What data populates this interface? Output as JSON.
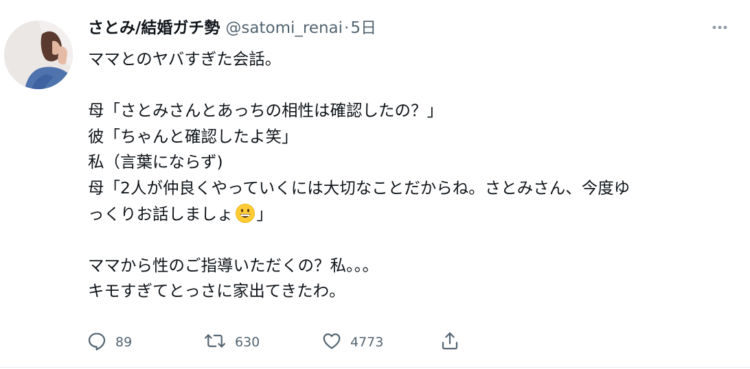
{
  "tweet": {
    "display_name": "さとみ/結婚ガチ勢",
    "handle": "@satomi_renai",
    "separator": "·",
    "time": "5日",
    "lines": [
      "ママとのヤバすぎた会話。",
      "",
      "母「さとみさんとあっちの相性は確認したの？」",
      "彼「ちゃんと確認したよ笑」",
      "私（言葉にならず)",
      "母「2人が仲良くやっていくには大切なことだからね。さとみさん、今度ゆ",
      "っくりお話しましょ",
      "",
      "ママから性のご指導いただくの？私。。。",
      "キモすぎてとっさに家出てきたわ。"
    ],
    "line7_tail": "」",
    "emoji": "grinning-face-emoji",
    "actions": {
      "reply_count": "89",
      "retweet_count": "630",
      "like_count": "4773"
    }
  },
  "icons": {
    "more": "more-icon",
    "reply": "reply-icon",
    "retweet": "retweet-icon",
    "like": "heart-icon",
    "share": "share-icon"
  },
  "colors": {
    "text": "#0f1419",
    "secondary": "#536471"
  }
}
